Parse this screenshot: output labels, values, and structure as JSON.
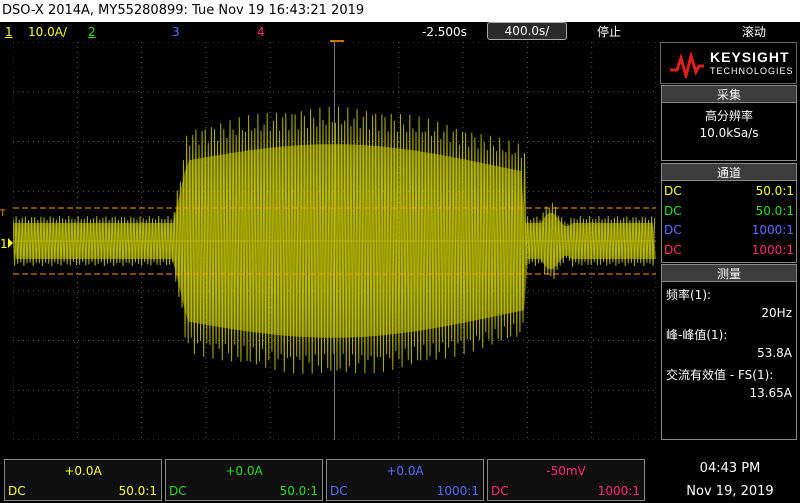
{
  "title": "DSO-X 2014A, MY55280899: Tue Nov 19 16:43:21 2019",
  "header": {
    "ch1_num": "1",
    "ch1_scale": "10.0A/",
    "ch2_num": "2",
    "ch3_num": "3",
    "ch4_num": "4",
    "delay": "-2.500s",
    "timebase": "400.0s/",
    "run_state": "停止",
    "mode": "滚动"
  },
  "panel": {
    "logo_line1": "KEYSIGHT",
    "logo_line2": "TECHNOLOGIES",
    "acq_title": "采集",
    "acq_mode": "高分辨率",
    "acq_rate": "10.0kSa/s",
    "chan_title": "通道",
    "channels": [
      {
        "coupling": "DC",
        "probe": "50.0:1",
        "color": "#ffff20"
      },
      {
        "coupling": "DC",
        "probe": "50.0:1",
        "color": "#20e020"
      },
      {
        "coupling": "DC",
        "probe": "1000:1",
        "color": "#5a6dff"
      },
      {
        "coupling": "DC",
        "probe": "1000:1",
        "color": "#ff2a7a"
      }
    ],
    "meas_title": "测量",
    "meas": [
      {
        "label": "频率(1):",
        "value": "20Hz"
      },
      {
        "label": "峰-峰值(1):",
        "value": "53.8A"
      },
      {
        "label": "交流有效值 - FS(1):",
        "value": "13.65A"
      }
    ]
  },
  "bottom": {
    "channels": [
      {
        "offset": "+0.0A",
        "coupling": "DC",
        "probe": "50.0:1",
        "color": "#ffff20"
      },
      {
        "offset": "+0.0A",
        "coupling": "DC",
        "probe": "50.0:1",
        "color": "#20e020"
      },
      {
        "offset": "+0.0A",
        "coupling": "DC",
        "probe": "1000:1",
        "color": "#5a6dff"
      },
      {
        "offset": "-50mV",
        "coupling": "DC",
        "probe": "1000:1",
        "color": "#ff2a7a"
      }
    ],
    "time": "04:43 PM",
    "date": "Nov 19, 2019"
  },
  "colors": {
    "trace": "#c8c800",
    "cursor": "#ff9a00",
    "grid": "#5a5a5a"
  }
}
